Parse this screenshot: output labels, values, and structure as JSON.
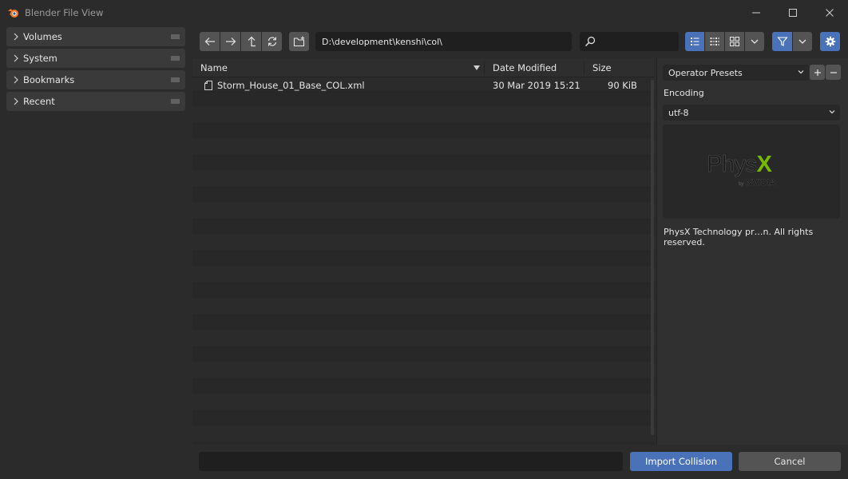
{
  "window": {
    "title": "Blender File View",
    "logo_color": "#f5792a",
    "controls": [
      "minimize-icon",
      "maximize-icon",
      "close-icon"
    ]
  },
  "sidebar": {
    "panels": [
      {
        "label": "Volumes"
      },
      {
        "label": "System"
      },
      {
        "label": "Bookmarks"
      },
      {
        "label": "Recent"
      }
    ]
  },
  "toolbar": {
    "nav_icons": [
      "back-icon",
      "forward-icon",
      "parent-directory-icon",
      "refresh-icon"
    ],
    "new_folder_icon": "new-folder-icon",
    "path": "D:\\development\\kenshi\\col\\",
    "search_value": "",
    "search_icon": "search-icon",
    "display_modes": [
      "vertical-list-icon",
      "horizontal-list-icon",
      "thumbnails-icon"
    ],
    "active_display_mode": "vertical-list",
    "filter_active": true,
    "accent_color": "#4a72b8"
  },
  "file_list": {
    "columns": [
      "Name",
      "Date Modified",
      "Size"
    ],
    "rows": [
      {
        "name": "Storm_House_01_Base_COL.xml",
        "date": "30 Mar 2019 15:21",
        "size": "90 KiB"
      }
    ]
  },
  "right_panel": {
    "presets_label": "Operator Presets",
    "encoding_label": "Encoding",
    "encoding_value": "utf-8",
    "logo_text_main": "Phys",
    "logo_text_x": "X",
    "logo_subtext_by": "by",
    "logo_subtext_brand": "NVIDIA",
    "logo_accent_color": "#76b900",
    "copyright": "PhysX Technology pr…n. All rights reserved."
  },
  "bottom": {
    "filename_value": "",
    "primary_label": "Import Collision",
    "cancel_label": "Cancel"
  }
}
